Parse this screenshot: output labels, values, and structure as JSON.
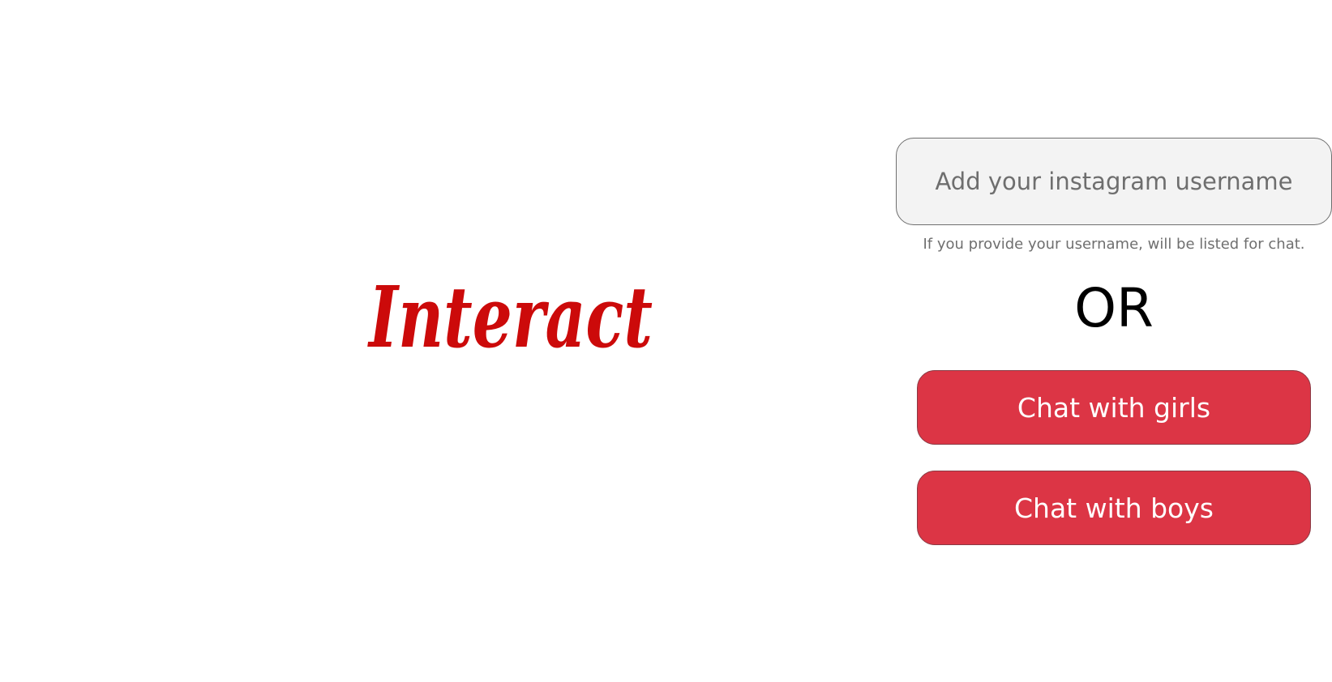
{
  "logo": {
    "text": "Interact",
    "color": "#cc0a0a"
  },
  "username": {
    "placeholder": "Add your instagram username",
    "value": "",
    "hint": "If you provide your username, will be listed for chat."
  },
  "divider": {
    "label": "OR"
  },
  "actions": {
    "chat_girls_label": "Chat with girls",
    "chat_boys_label": "Chat with boys",
    "button_color": "#dc3545"
  }
}
